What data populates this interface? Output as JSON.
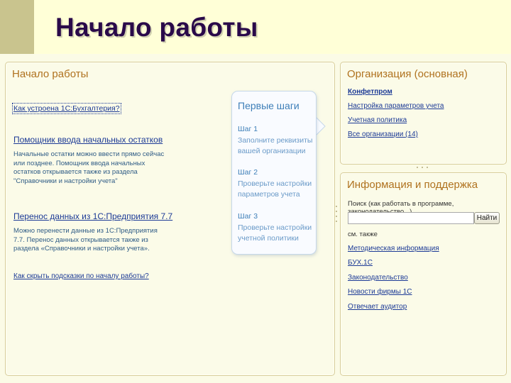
{
  "slide": {
    "title": "Начало работы"
  },
  "left_panel": {
    "title": "Начало работы",
    "link_how": "Как устроена 1С:Бухгалтерия?",
    "link_wizard": "Помощник ввода начальных остатков",
    "wizard_desc": "Начальные остатки можно ввести прямо сейчас\nили позднее. Помощник ввода начальных\nостатков открывается также из раздела\n\"Справочники и настройки учета\"",
    "link_transfer": "Перенос данных из 1С:Предприятия 7.7",
    "transfer_desc": "Можно перенести данные из 1С:Предприятия\n7.7. Перенос данных открывается также из\nраздела «Справочники и настройки учета».",
    "link_hide": "Как скрыть подсказки по началу работы?"
  },
  "first_steps": {
    "title": "Первые шаги",
    "steps": [
      {
        "label": "Шаг 1",
        "text": "Заполните реквизиты\nвашей организации"
      },
      {
        "label": "Шаг 2",
        "text": "Проверьте настройки\nпараметров учета"
      },
      {
        "label": "Шаг 3",
        "text": "Проверьте настройки\nучетной политики"
      }
    ]
  },
  "org_panel": {
    "title": "Организация (основная)",
    "links": [
      "Конфетпром",
      "Настройка параметров учета",
      "Учетная политика",
      "Все организации (14)"
    ]
  },
  "info_panel": {
    "title": "Информация и поддержка",
    "search_label": "Поиск (как работать в программе, законодательство...)",
    "search_value": "",
    "search_button": "Найти",
    "see_also": "см. также",
    "links": [
      "Методическая информация",
      "БУХ.1С",
      "Законодательство",
      "Новости фирмы 1С",
      "Отвечает аудитор"
    ]
  },
  "colors": {
    "title_text": "#2a0a4a",
    "title_band": "#ffffd7",
    "panel_heading": "#b0721f",
    "link": "#1c3a96",
    "step_text": "#3e7fb8"
  }
}
